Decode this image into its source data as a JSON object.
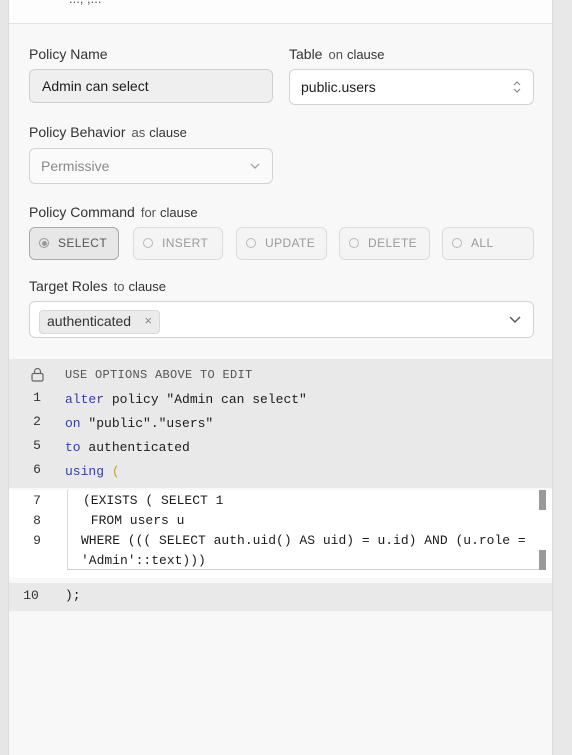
{
  "top_bar": {
    "cut_text": "..., ,..."
  },
  "policy_name": {
    "label": "Policy Name",
    "value": "Admin can select"
  },
  "table": {
    "label": "Table",
    "clause_kw": "on",
    "clause_word": "clause",
    "value": "public.users"
  },
  "behavior": {
    "label": "Policy Behavior",
    "clause_kw": "as",
    "clause_word": "clause",
    "value": "Permissive"
  },
  "command": {
    "label": "Policy Command",
    "clause_kw": "for",
    "clause_word": "clause",
    "options": [
      "SELECT",
      "INSERT",
      "UPDATE",
      "DELETE",
      "ALL"
    ],
    "selected": "SELECT"
  },
  "roles": {
    "label": "Target Roles",
    "clause_kw": "to",
    "clause_word": "clause",
    "chip": "authenticated",
    "chip_remove": "×"
  },
  "editor": {
    "hint": "USE OPTIONS ABOVE TO EDIT",
    "line_numbers": [
      "1",
      "2",
      "5",
      "6",
      "7",
      "8",
      "9",
      "10"
    ],
    "lines": [
      {
        "kw": "alter",
        "rest": " policy \"Admin can select\""
      },
      {
        "kw": "on",
        "rest": " \"public\".\"users\""
      },
      {
        "kw": "to",
        "rest": " authenticated"
      },
      {
        "kw": "using",
        "rest": " ("
      }
    ],
    "body": [
      "(EXISTS ( SELECT 1",
      " FROM users u",
      "WHERE ((( SELECT auth.uid() AS uid) = u.id) AND (u.role =",
      "'Admin'::text)))"
    ],
    "closing": ");"
  },
  "colors": {
    "keyword": "#2f3eb3",
    "string": "#a31515",
    "bracket": "#c9a227"
  }
}
